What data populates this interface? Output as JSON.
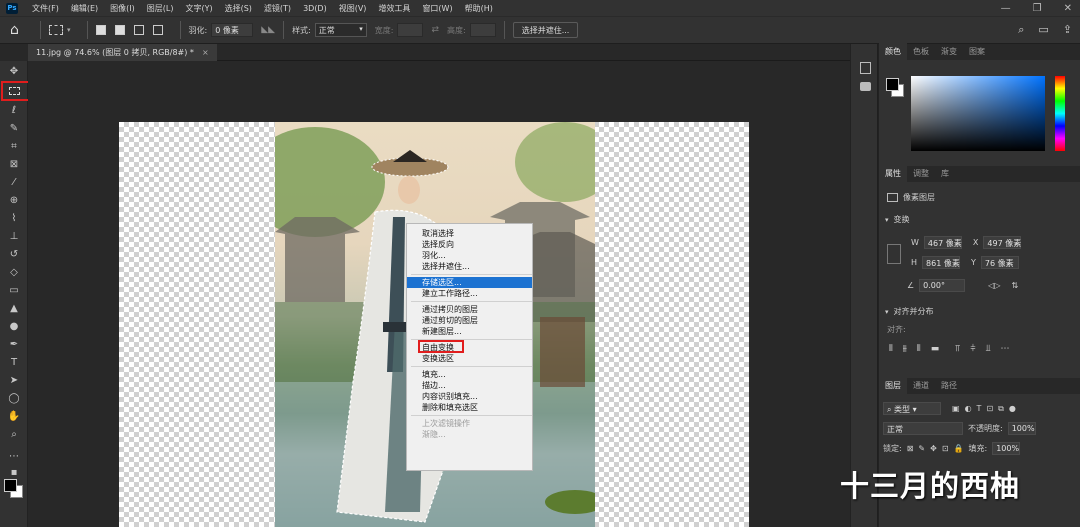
{
  "menubar": {
    "logo": "Ps",
    "items": [
      "文件(F)",
      "编辑(E)",
      "图像(I)",
      "图层(L)",
      "文字(Y)",
      "选择(S)",
      "滤镜(T)",
      "3D(D)",
      "视图(V)",
      "增效工具",
      "窗口(W)",
      "帮助(H)"
    ]
  },
  "options": {
    "feather_label": "羽化:",
    "feather_value": "0 像素",
    "style_label": "样式:",
    "style_value": "正常",
    "width_label": "宽度:",
    "height_label": "高度:",
    "select_mask_button": "选择并遮住..."
  },
  "document": {
    "tab_title": "11.jpg @ 74.6% (图层 0 拷贝, RGB/8#) *",
    "close": "×"
  },
  "context_menu": {
    "groups": [
      [
        "取消选择",
        "选择反向",
        "羽化...",
        "选择并遮住..."
      ],
      [
        "存储选区...",
        "建立工作路径..."
      ],
      [
        "通过拷贝的图层",
        "通过剪切的图层",
        "新建图层..."
      ],
      [
        "自由变换",
        "变换选区"
      ],
      [
        "填充...",
        "描边...",
        "内容识别填充...",
        "删除和填充选区"
      ],
      [
        "上次滤镜操作",
        "渐隐..."
      ]
    ],
    "active_item": "存储选区..."
  },
  "color_panel": {
    "tabs": [
      "颜色",
      "色板",
      "渐变",
      "图案"
    ]
  },
  "properties_panel": {
    "tabs": [
      "属性",
      "调整",
      "库"
    ],
    "layer_type": "像素图层",
    "transform_title": "变换",
    "w_label": "W",
    "w_value": "467 像素",
    "x_label": "X",
    "x_value": "497 像素",
    "h_label": "H",
    "h_value": "861 像素",
    "y_label": "Y",
    "y_value": "76 像素",
    "angle_value": "0.00°",
    "align_title": "对齐并分布",
    "align_label": "对齐:"
  },
  "layers_panel": {
    "tabs": [
      "图层",
      "通道",
      "路径"
    ],
    "filter_kind": "类型",
    "blend_mode": "正常",
    "opacity_label": "不透明度:",
    "opacity_value": "100%",
    "lock_label": "锁定:",
    "fill_label": "填充:",
    "fill_value": "100%"
  },
  "watermark": "十三月的西柚",
  "colors": {
    "accent": "#1c72d1",
    "highlight": "#e11d1d",
    "panel": "#323232"
  }
}
